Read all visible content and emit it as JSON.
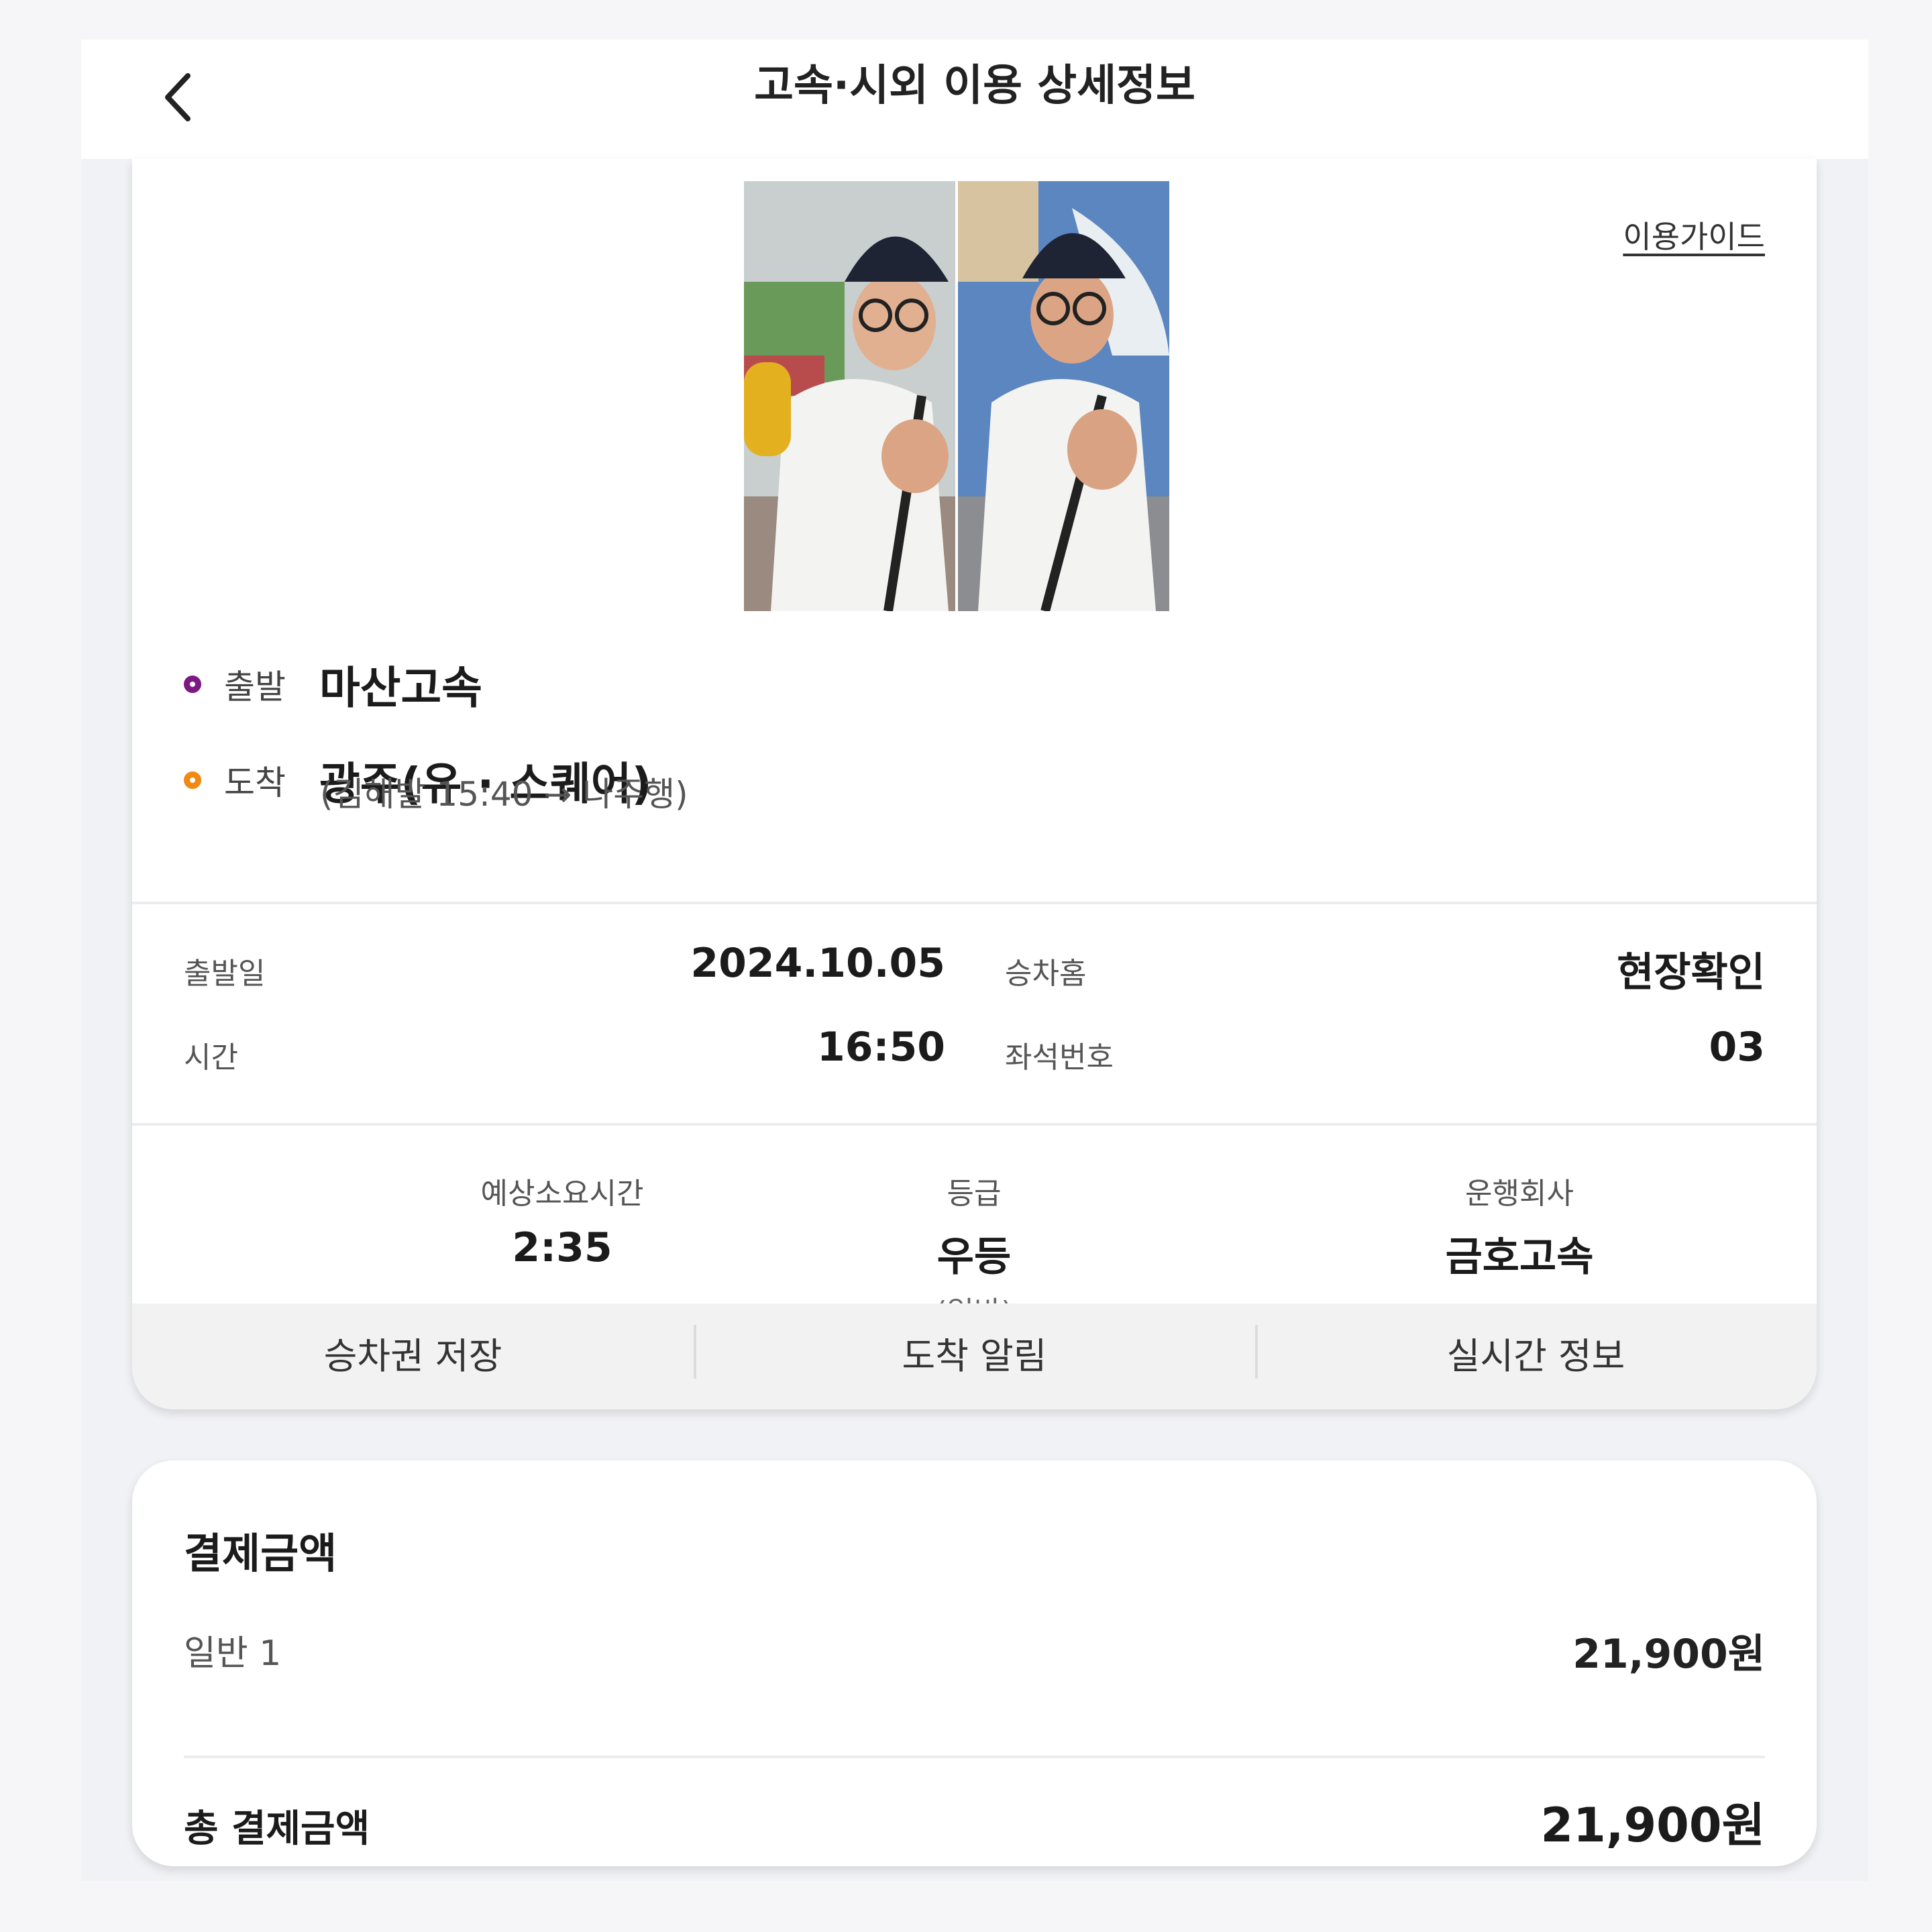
{
  "header": {
    "title": "고속·시외 이용 상세정보",
    "back_icon": "chevron-left-icon"
  },
  "ticket": {
    "guide_link": "이용가이드",
    "departure": {
      "label": "출발",
      "station": "마산고속",
      "dot_color": "#7b1a85"
    },
    "arrival": {
      "label": "도착",
      "station": "광주(유 · 스퀘어)",
      "route_note": "(김해발 15:40 → 나주행)",
      "dot_color": "#f08a14"
    },
    "details": [
      {
        "label": "출발일",
        "value": "2024.10.05"
      },
      {
        "label": "승차홈",
        "value": "현장확인"
      },
      {
        "label": "시간",
        "value": "16:50"
      },
      {
        "label": "좌석번호",
        "value": "03"
      }
    ],
    "stats": [
      {
        "label": "예상소요시간",
        "value": "2:35",
        "sub": ""
      },
      {
        "label": "등급",
        "value": "우등",
        "sub": "(일반)"
      },
      {
        "label": "운행회사",
        "value": "금호고속",
        "sub": ""
      }
    ],
    "actions": [
      "승차권 저장",
      "도착 알림",
      "실시간 정보"
    ]
  },
  "payment": {
    "title": "결제금액",
    "row_label": "일반 1",
    "row_value": "21,900원",
    "total_label": "총 결제금액",
    "total_value": "21,900원"
  }
}
